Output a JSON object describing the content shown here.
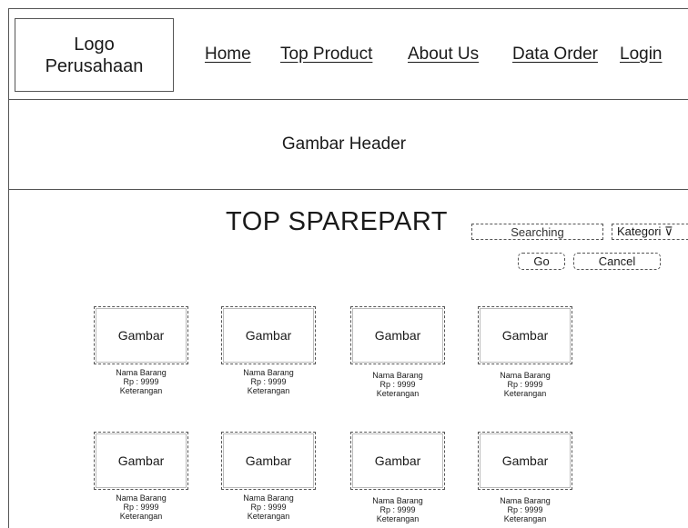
{
  "navbar": {
    "logo_line1": "Logo",
    "logo_line2": "Perusahaan",
    "links": [
      "Home",
      "Top Product",
      "About Us",
      "Data Order",
      "Login"
    ]
  },
  "header": {
    "label": "Gambar Header"
  },
  "main": {
    "title": "TOP SPAREPART",
    "search_value": "Searching",
    "category_label": "Kategori ⊽",
    "go_label": "Go",
    "cancel_label": "Cancel"
  },
  "products": [
    {
      "image": "Gambar",
      "name": "Nama Barang",
      "price": "Rp : 9999",
      "desc": "Keterangan"
    },
    {
      "image": "Gambar",
      "name": "Nama Barang",
      "price": "Rp : 9999",
      "desc": "Keterangan"
    },
    {
      "image": "Gambar",
      "name": "Nama Barang",
      "price": "Rp : 9999",
      "desc": "Keterangan"
    },
    {
      "image": "Gambar",
      "name": "Nama Barang",
      "price": "Rp : 9999",
      "desc": "Keterangan"
    },
    {
      "image": "Gambar",
      "name": "Nama Barang",
      "price": "Rp : 9999",
      "desc": "Keterangan"
    },
    {
      "image": "Gambar",
      "name": "Nama Barang",
      "price": "Rp : 9999",
      "desc": "Keterangan"
    },
    {
      "image": "Gambar",
      "name": "Nama Barang",
      "price": "Rp : 9999",
      "desc": "Keterangan"
    },
    {
      "image": "Gambar",
      "name": "Nama Barang",
      "price": "Rp : 9999",
      "desc": "Keterangan"
    }
  ]
}
